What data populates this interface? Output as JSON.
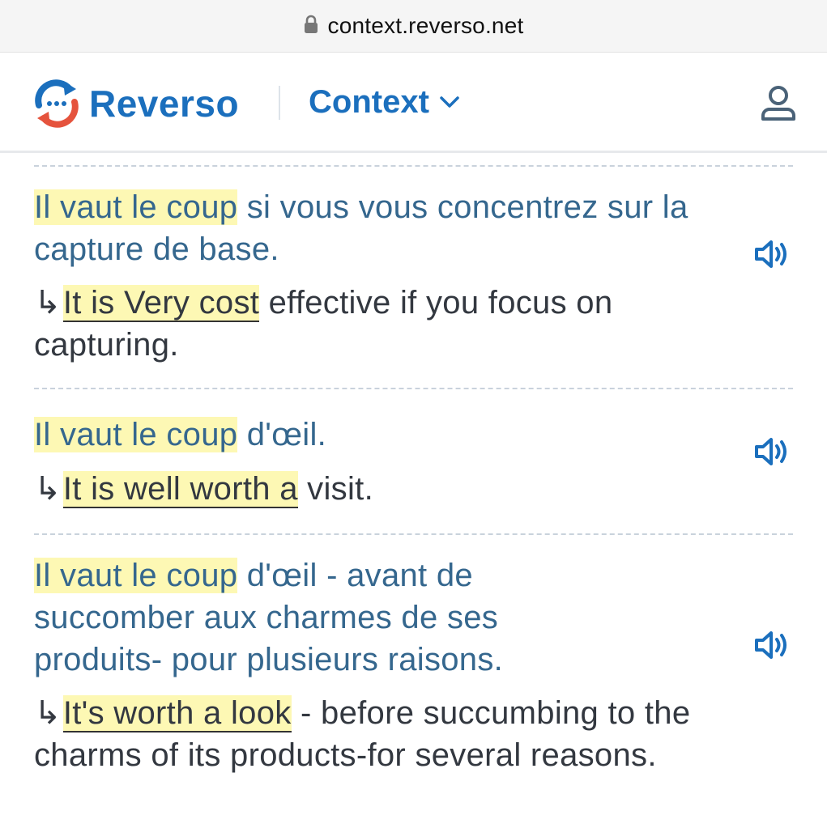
{
  "browser": {
    "url": "context.reverso.net"
  },
  "header": {
    "brand": "Reverso",
    "product": "Context"
  },
  "icons": {
    "lock": "lock-icon",
    "logo": "reverso-logo-icon",
    "chevron": "chevron-down-icon",
    "user": "user-icon",
    "speaker": "speaker-icon",
    "arrow": "return-arrow-icon"
  },
  "colors": {
    "brand_blue": "#1b6fbd",
    "source_text": "#35678e",
    "target_text": "#333840",
    "highlight": "#fdf8b4",
    "logo_red": "#e5533d"
  },
  "examples": [
    {
      "source_highlight": "Il vaut le coup",
      "source_rest": " si vous vous concentrez sur la capture de base.",
      "arrow": "↳",
      "target_highlight": "It is Very cost",
      "target_rest": " effective if you focus on capturing."
    },
    {
      "source_highlight": "Il vaut le coup",
      "source_rest": " d'œil.",
      "arrow": "↳",
      "target_highlight": "It is well worth a",
      "target_rest": " visit."
    },
    {
      "source_highlight": "Il vaut le coup",
      "source_rest": " d'œil - avant de succomber aux charmes de ses produits- pour plusieurs raisons.",
      "arrow": "↳",
      "target_highlight": "It's worth a look",
      "target_rest": " - before succumbing to the charms of its products-for several reasons."
    }
  ]
}
